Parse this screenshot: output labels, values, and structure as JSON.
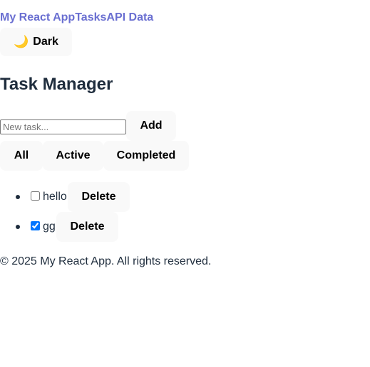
{
  "nav": {
    "brand": "My React App",
    "links": [
      "Tasks",
      "API Data"
    ]
  },
  "theme_toggle": {
    "icon": "moon-icon",
    "glyph": "🌙",
    "label": "Dark"
  },
  "page_title": "Task Manager",
  "new_task": {
    "placeholder": "New task...",
    "value": "",
    "add_label": "Add"
  },
  "filters": [
    "All",
    "Active",
    "Completed"
  ],
  "tasks": [
    {
      "text": "hello",
      "completed": false,
      "delete_label": "Delete"
    },
    {
      "text": "gg",
      "completed": true,
      "delete_label": "Delete"
    }
  ],
  "footer": "© 2025 My React App. All rights reserved.",
  "colors": {
    "nav_link": "#6a6fd1",
    "text": "#1f2d3d",
    "button_bg": "#f9f9f9"
  }
}
